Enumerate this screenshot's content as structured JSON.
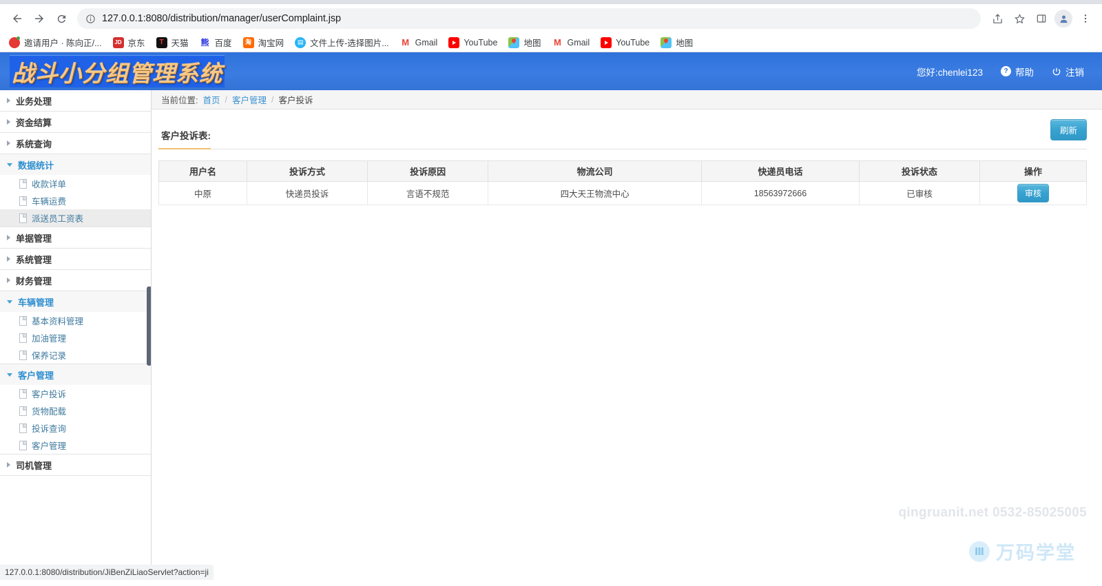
{
  "browser": {
    "nav": {
      "back": "back-arrow",
      "forward": "forward-arrow",
      "reload": "reload"
    },
    "url": "127.0.0.1:8080/distribution/manager/userComplaint.jsp",
    "toolbar_icons": [
      "share-icon",
      "bookmark-star-icon",
      "side-panel-icon",
      "profile-avatar-icon",
      "kebab-menu-icon"
    ],
    "bookmarks": [
      {
        "label": "邀请用户 · 陈向正/...",
        "icon": "fav-invite"
      },
      {
        "label": "京东",
        "icon": "fav-jd",
        "glyph": "JD"
      },
      {
        "label": "天猫",
        "icon": "fav-tm",
        "glyph": "T"
      },
      {
        "label": "百度",
        "icon": "fav-bd",
        "glyph": "熊"
      },
      {
        "label": "淘宝网",
        "icon": "fav-tb",
        "glyph": "淘"
      },
      {
        "label": "文件上传-选择图片...",
        "icon": "fav-up",
        "glyph": "▤"
      },
      {
        "label": "Gmail",
        "icon": "fav-gm",
        "glyph": "M"
      },
      {
        "label": "YouTube",
        "icon": "fav-yt",
        "glyph": ""
      },
      {
        "label": "地图",
        "icon": "fav-map",
        "glyph": ""
      },
      {
        "label": "Gmail",
        "icon": "fav-gm",
        "glyph": "M"
      },
      {
        "label": "YouTube",
        "icon": "fav-yt",
        "glyph": ""
      },
      {
        "label": "地图",
        "icon": "fav-map",
        "glyph": ""
      }
    ],
    "status_url": "127.0.0.1:8080/distribution/JiBenZiLiaoServlet?action=ji"
  },
  "header": {
    "logo_text": "战斗小分组管理系统",
    "greeting": "您好:chenlei123",
    "help": "帮助",
    "logout": "注销"
  },
  "sidebar": {
    "groups": [
      {
        "label": "业务处理",
        "open": false,
        "items": []
      },
      {
        "label": "资金结算",
        "open": false,
        "items": []
      },
      {
        "label": "系统查询",
        "open": false,
        "items": []
      },
      {
        "label": "数据统计",
        "open": true,
        "items": [
          {
            "label": "收款详单",
            "active": false
          },
          {
            "label": "车辆运费",
            "active": false
          },
          {
            "label": "派送员工资表",
            "active": true
          }
        ]
      },
      {
        "label": "单据管理",
        "open": false,
        "items": []
      },
      {
        "label": "系统管理",
        "open": false,
        "items": []
      },
      {
        "label": "财务管理",
        "open": false,
        "items": []
      },
      {
        "label": "车辆管理",
        "open": true,
        "items": [
          {
            "label": "基本资料管理",
            "active": false
          },
          {
            "label": "加油管理",
            "active": false
          },
          {
            "label": "保养记录",
            "active": false
          }
        ]
      },
      {
        "label": "客户管理",
        "open": true,
        "items": [
          {
            "label": "客户投诉",
            "active": false
          },
          {
            "label": "货物配载",
            "active": false
          },
          {
            "label": "投诉查询",
            "active": false
          },
          {
            "label": "客户管理",
            "active": false
          }
        ]
      },
      {
        "label": "司机管理",
        "open": false,
        "items": []
      }
    ]
  },
  "breadcrumb": {
    "prefix": "当前位置:",
    "home": "首页",
    "section": "客户管理",
    "current": "客户投诉",
    "separator": "/"
  },
  "panel": {
    "title": "客户投诉表:",
    "refresh_label": "刷新"
  },
  "table": {
    "columns": [
      "用户名",
      "投诉方式",
      "投诉原因",
      "物流公司",
      "快递员电话",
      "投诉状态",
      "操作"
    ],
    "rows": [
      {
        "用户名": "中原",
        "投诉方式": "快递员投诉",
        "投诉原因": "言语不规范",
        "物流公司": "四大天王物流中心",
        "快递员电话": "18563972666",
        "投诉状态": "已审核",
        "操作": "审核"
      }
    ]
  },
  "watermark": {
    "text": "qingruanit.net 0532-85025005",
    "logo_text": "万码学堂",
    "logo_glyph": "Ⅲ"
  },
  "colors": {
    "header_blue": "#3a7ce2",
    "logo_gold": "#f5c98a",
    "button_blue": "#37a2d0",
    "link_blue": "#3d92d0",
    "title_underline": "#f0c070"
  }
}
